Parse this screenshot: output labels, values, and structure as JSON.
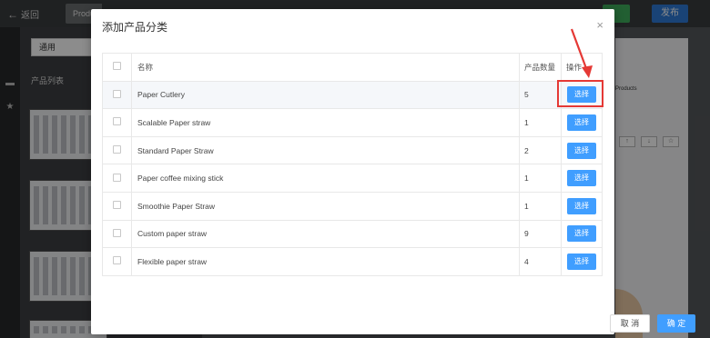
{
  "topbar": {
    "back_label": "返回",
    "tab_label": "Produ",
    "publish_label": "发布"
  },
  "side_panel": {
    "select_value": "通用",
    "heading": "产品列表"
  },
  "canvas": {
    "label": "Products",
    "tools": [
      "↑",
      "↓",
      "☆"
    ]
  },
  "modal": {
    "title": "添加产品分类",
    "close_glyph": "×",
    "columns": {
      "name": "名称",
      "count": "产品数量",
      "action": "操作"
    },
    "rows": [
      {
        "name": "Paper Cutlery",
        "count": "5",
        "action": "选择"
      },
      {
        "name": "Scalable Paper straw",
        "count": "1",
        "action": "选择"
      },
      {
        "name": "Standard Paper Straw",
        "count": "2",
        "action": "选择"
      },
      {
        "name": "Paper coffee mixing stick",
        "count": "1",
        "action": "选择"
      },
      {
        "name": "Smoothie Paper Straw",
        "count": "1",
        "action": "选择"
      },
      {
        "name": "Custom paper straw",
        "count": "9",
        "action": "选择"
      },
      {
        "name": "Flexible paper straw",
        "count": "4",
        "action": "选择"
      }
    ],
    "cancel_label": "取 消",
    "confirm_label": "确 定"
  },
  "colors": {
    "primary": "#409eff",
    "highlight": "#e53935",
    "overlay": "rgba(0,0,0,0.45)"
  }
}
